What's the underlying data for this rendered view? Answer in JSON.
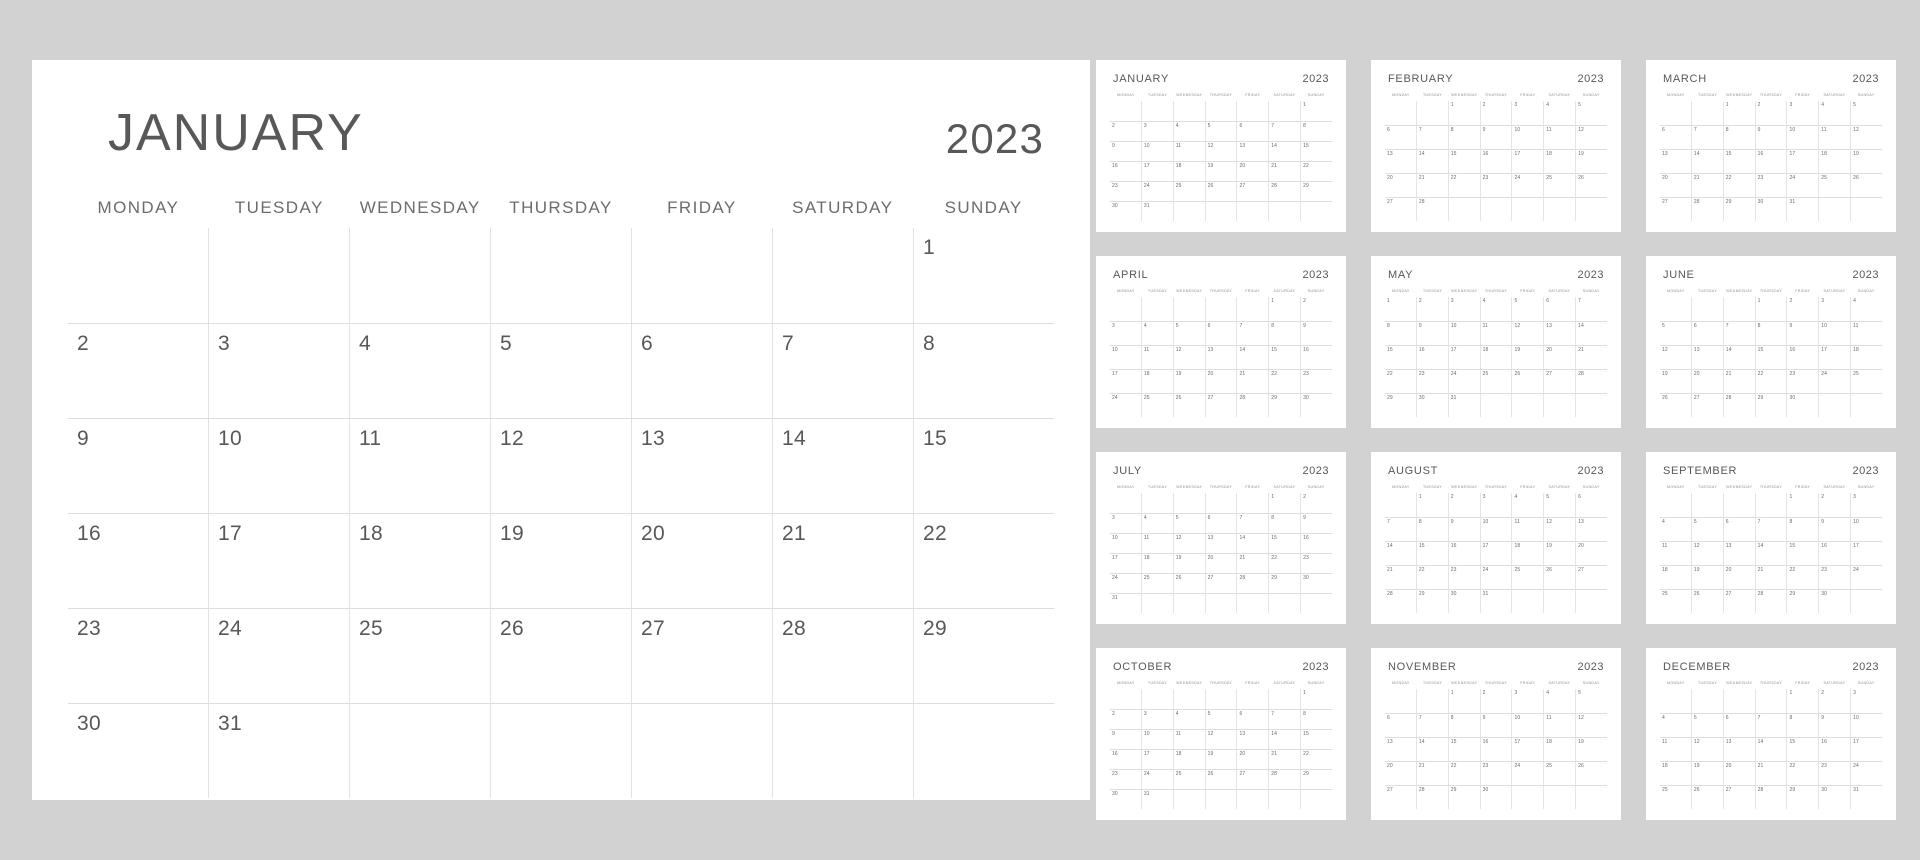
{
  "theme": {
    "background": "#d2d2d2",
    "card_background": "#ffffff",
    "text_color": "#58585a",
    "muted_text_color": "#6c6c6e",
    "grid_line_color": "#dededf"
  },
  "year": "2023",
  "weekday_headers": [
    "MONDAY",
    "TUESDAY",
    "WEDNESDAY",
    "THURSDAY",
    "FRIDAY",
    "SATURDAY",
    "SUNDAY"
  ],
  "main_calendar": {
    "month": "JANUARY",
    "year": "2023",
    "weeks": [
      [
        "",
        "",
        "",
        "",
        "",
        "",
        "1"
      ],
      [
        "2",
        "3",
        "4",
        "5",
        "6",
        "7",
        "8"
      ],
      [
        "9",
        "10",
        "11",
        "12",
        "13",
        "14",
        "15"
      ],
      [
        "16",
        "17",
        "18",
        "19",
        "20",
        "21",
        "22"
      ],
      [
        "23",
        "24",
        "25",
        "26",
        "27",
        "28",
        "29"
      ],
      [
        "30",
        "31",
        "",
        "",
        "",
        "",
        ""
      ]
    ]
  },
  "mini_calendars": [
    {
      "month": "JANUARY",
      "year": "2023",
      "weeks": [
        [
          "",
          "",
          "",
          "",
          "",
          "",
          "1"
        ],
        [
          "2",
          "3",
          "4",
          "5",
          "6",
          "7",
          "8"
        ],
        [
          "9",
          "10",
          "11",
          "12",
          "13",
          "14",
          "15"
        ],
        [
          "16",
          "17",
          "18",
          "19",
          "20",
          "21",
          "22"
        ],
        [
          "23",
          "24",
          "25",
          "26",
          "27",
          "28",
          "29"
        ],
        [
          "30",
          "31",
          "",
          "",
          "",
          "",
          ""
        ]
      ]
    },
    {
      "month": "FEBRUARY",
      "year": "2023",
      "weeks": [
        [
          "",
          "",
          "1",
          "2",
          "3",
          "4",
          "5"
        ],
        [
          "6",
          "7",
          "8",
          "9",
          "10",
          "11",
          "12"
        ],
        [
          "13",
          "14",
          "15",
          "16",
          "17",
          "18",
          "19"
        ],
        [
          "20",
          "21",
          "22",
          "23",
          "24",
          "25",
          "26"
        ],
        [
          "27",
          "28",
          "",
          "",
          "",
          "",
          ""
        ]
      ]
    },
    {
      "month": "MARCH",
      "year": "2023",
      "weeks": [
        [
          "",
          "",
          "1",
          "2",
          "3",
          "4",
          "5"
        ],
        [
          "6",
          "7",
          "8",
          "9",
          "10",
          "11",
          "12"
        ],
        [
          "13",
          "14",
          "15",
          "16",
          "17",
          "18",
          "19"
        ],
        [
          "20",
          "21",
          "22",
          "23",
          "24",
          "25",
          "26"
        ],
        [
          "27",
          "28",
          "29",
          "30",
          "31",
          "",
          ""
        ]
      ]
    },
    {
      "month": "APRIL",
      "year": "2023",
      "weeks": [
        [
          "",
          "",
          "",
          "",
          "",
          "1",
          "2"
        ],
        [
          "3",
          "4",
          "5",
          "6",
          "7",
          "8",
          "9"
        ],
        [
          "10",
          "11",
          "12",
          "13",
          "14",
          "15",
          "16"
        ],
        [
          "17",
          "18",
          "19",
          "20",
          "21",
          "22",
          "23"
        ],
        [
          "24",
          "25",
          "26",
          "27",
          "28",
          "29",
          "30"
        ]
      ]
    },
    {
      "month": "MAY",
      "year": "2023",
      "weeks": [
        [
          "1",
          "2",
          "3",
          "4",
          "5",
          "6",
          "7"
        ],
        [
          "8",
          "9",
          "10",
          "11",
          "12",
          "13",
          "14"
        ],
        [
          "15",
          "16",
          "17",
          "18",
          "19",
          "20",
          "21"
        ],
        [
          "22",
          "23",
          "24",
          "25",
          "26",
          "27",
          "28"
        ],
        [
          "29",
          "30",
          "31",
          "",
          "",
          "",
          ""
        ]
      ]
    },
    {
      "month": "JUNE",
      "year": "2023",
      "weeks": [
        [
          "",
          "",
          "",
          "1",
          "2",
          "3",
          "4"
        ],
        [
          "5",
          "6",
          "7",
          "8",
          "9",
          "10",
          "11"
        ],
        [
          "12",
          "13",
          "14",
          "15",
          "16",
          "17",
          "18"
        ],
        [
          "19",
          "20",
          "21",
          "22",
          "23",
          "24",
          "25"
        ],
        [
          "26",
          "27",
          "28",
          "29",
          "30",
          "",
          ""
        ]
      ]
    },
    {
      "month": "JULY",
      "year": "2023",
      "weeks": [
        [
          "",
          "",
          "",
          "",
          "",
          "1",
          "2"
        ],
        [
          "3",
          "4",
          "5",
          "6",
          "7",
          "8",
          "9"
        ],
        [
          "10",
          "11",
          "12",
          "13",
          "14",
          "15",
          "16"
        ],
        [
          "17",
          "18",
          "19",
          "20",
          "21",
          "22",
          "23"
        ],
        [
          "24",
          "25",
          "26",
          "27",
          "28",
          "29",
          "30"
        ],
        [
          "31",
          "",
          "",
          "",
          "",
          "",
          ""
        ]
      ]
    },
    {
      "month": "AUGUST",
      "year": "2023",
      "weeks": [
        [
          "",
          "1",
          "2",
          "3",
          "4",
          "5",
          "6"
        ],
        [
          "7",
          "8",
          "9",
          "10",
          "11",
          "12",
          "13"
        ],
        [
          "14",
          "15",
          "16",
          "17",
          "18",
          "19",
          "20"
        ],
        [
          "21",
          "22",
          "23",
          "24",
          "25",
          "26",
          "27"
        ],
        [
          "28",
          "29",
          "30",
          "31",
          "",
          "",
          ""
        ]
      ]
    },
    {
      "month": "SEPTEMBER",
      "year": "2023",
      "weeks": [
        [
          "",
          "",
          "",
          "",
          "1",
          "2",
          "3"
        ],
        [
          "4",
          "5",
          "6",
          "7",
          "8",
          "9",
          "10"
        ],
        [
          "11",
          "12",
          "13",
          "14",
          "15",
          "16",
          "17"
        ],
        [
          "18",
          "19",
          "20",
          "21",
          "22",
          "23",
          "24"
        ],
        [
          "25",
          "26",
          "27",
          "28",
          "29",
          "30",
          ""
        ]
      ]
    },
    {
      "month": "OCTOBER",
      "year": "2023",
      "weeks": [
        [
          "",
          "",
          "",
          "",
          "",
          "",
          "1"
        ],
        [
          "2",
          "3",
          "4",
          "5",
          "6",
          "7",
          "8"
        ],
        [
          "9",
          "10",
          "11",
          "12",
          "13",
          "14",
          "15"
        ],
        [
          "16",
          "17",
          "18",
          "19",
          "20",
          "21",
          "22"
        ],
        [
          "23",
          "24",
          "25",
          "26",
          "27",
          "28",
          "29"
        ],
        [
          "30",
          "31",
          "",
          "",
          "",
          "",
          ""
        ]
      ]
    },
    {
      "month": "NOVEMBER",
      "year": "2023",
      "weeks": [
        [
          "",
          "",
          "1",
          "2",
          "3",
          "4",
          "5"
        ],
        [
          "6",
          "7",
          "8",
          "9",
          "10",
          "11",
          "12"
        ],
        [
          "13",
          "14",
          "15",
          "16",
          "17",
          "18",
          "19"
        ],
        [
          "20",
          "21",
          "22",
          "23",
          "24",
          "25",
          "26"
        ],
        [
          "27",
          "28",
          "29",
          "30",
          "",
          "",
          ""
        ]
      ]
    },
    {
      "month": "DECEMBER",
      "year": "2023",
      "weeks": [
        [
          "",
          "",
          "",
          "",
          "1",
          "2",
          "3"
        ],
        [
          "4",
          "5",
          "6",
          "7",
          "8",
          "9",
          "10"
        ],
        [
          "11",
          "12",
          "13",
          "14",
          "15",
          "16",
          "17"
        ],
        [
          "18",
          "19",
          "20",
          "21",
          "22",
          "23",
          "24"
        ],
        [
          "25",
          "26",
          "27",
          "28",
          "29",
          "30",
          "31"
        ]
      ]
    }
  ]
}
